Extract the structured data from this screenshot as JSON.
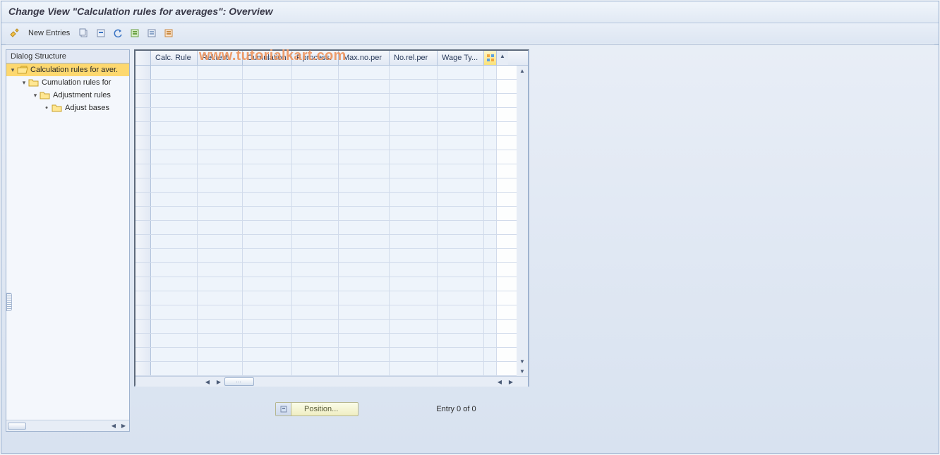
{
  "title": "Change View \"Calculation rules for averages\": Overview",
  "toolbar": {
    "new_entries_label": "New Entries"
  },
  "watermark": "www.tutorialkart.com",
  "tree": {
    "header": "Dialog Structure",
    "items": [
      {
        "label": "Calculation rules for aver.",
        "selected": true,
        "icon": "folder-open",
        "indent": 0,
        "expander": "▾"
      },
      {
        "label": "Cumulation rules for ",
        "selected": false,
        "icon": "folder",
        "indent": 1,
        "expander": "▾"
      },
      {
        "label": "Adjustment rules",
        "selected": false,
        "icon": "folder",
        "indent": 2,
        "expander": "▾"
      },
      {
        "label": "Adjust bases",
        "selected": false,
        "icon": "folder",
        "indent": 3,
        "expander": "•"
      }
    ]
  },
  "table": {
    "columns": [
      "Calc. Rule",
      "Rel.test",
      "Cumulation",
      "F.process.",
      "Max.no.per",
      "No.rel.per",
      "Wage Ty..."
    ],
    "row_count": 22
  },
  "footer": {
    "position_label": "Position...",
    "entry_text": "Entry 0 of 0"
  }
}
